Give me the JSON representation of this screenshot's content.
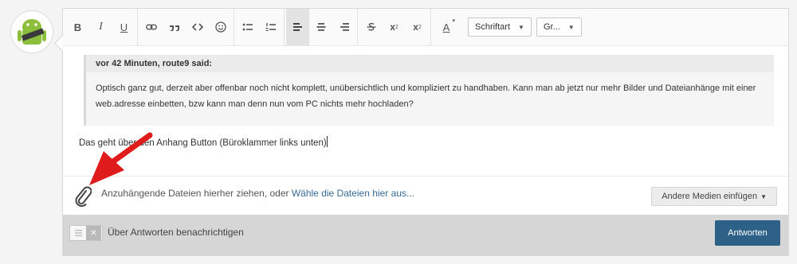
{
  "toolbar": {
    "bold_label": "B",
    "italic_label": "I",
    "underline_label": "U",
    "superscript_label": "x",
    "subscript_label": "x",
    "font_color_label": "A",
    "font_family_value": "Schriftart",
    "font_size_value": "Gr..."
  },
  "quote": {
    "header": "vor 42 Minuten, route9 said:",
    "body": "Optisch ganz gut, derzeit aber offenbar noch nicht komplett, unübersichtlich und kompliziert zu handhaben. Kann man ab jetzt nur mehr Bilder und Dateianhänge mit einer web.adresse einbetten, bzw kann man denn nun vom PC nichts mehr hochladen?"
  },
  "editor": {
    "text": "Das geht über den Anhang Button (Büroklammer links unten)"
  },
  "attachments": {
    "drop_text": "Anzuhängende Dateien hierher ziehen, oder ",
    "choose_link": "Wähle die Dateien hier aus...",
    "other_media_button": "Andere Medien einfügen"
  },
  "footer": {
    "notify_label": "Über Antworten benachrichtigen",
    "submit_label": "Antworten"
  },
  "colors": {
    "accent": "#2d6188",
    "link": "#3a6c98",
    "annotation_arrow": "#e01b1b"
  }
}
